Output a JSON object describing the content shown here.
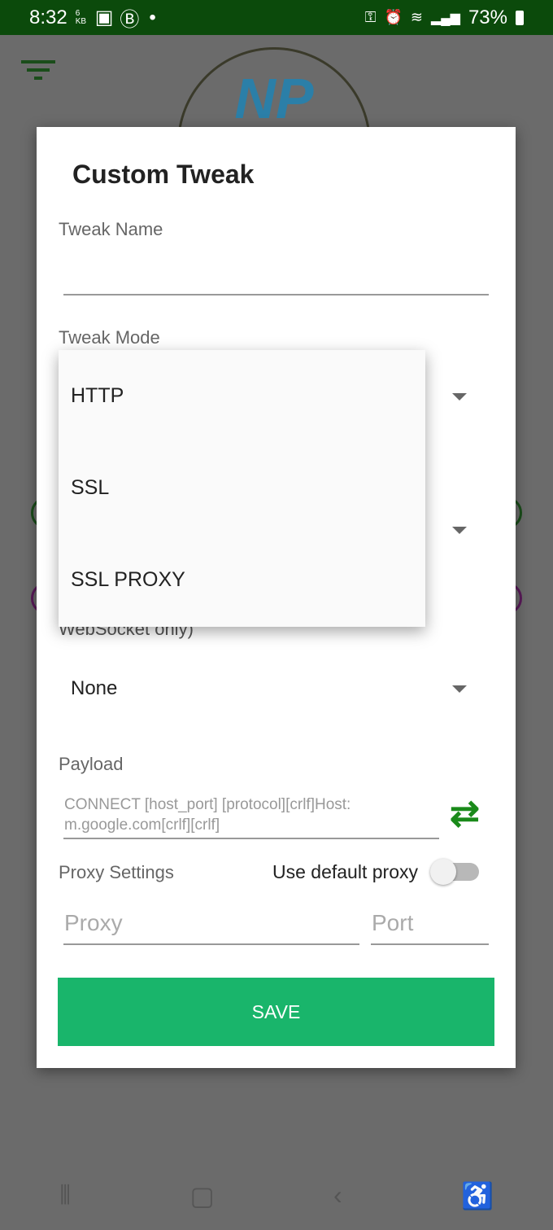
{
  "status_bar": {
    "time": "8:32",
    "data_speed": "6 KB",
    "battery": "73%",
    "left_icons": [
      "gallery-icon",
      "b-icon",
      "dot-icon"
    ],
    "right_icons": [
      "vpn-key-icon",
      "alarm-icon",
      "wifi-icon",
      "signal-icon",
      "volte-icon",
      "battery-icon"
    ]
  },
  "background": {
    "logo_text": "NP"
  },
  "dialog": {
    "title": "Custom Tweak",
    "tweak_name_label": "Tweak Name",
    "tweak_name_value": "",
    "tweak_mode_label": "Tweak Mode",
    "hidden_label_tail": "WebSocket only)",
    "websocket_value": "None",
    "payload_label": "Payload",
    "payload_placeholder": "CONNECT [host_port] [protocol][crlf]Host: m.google.com[crlf][crlf]",
    "proxy_settings_label": "Proxy Settings",
    "use_default_proxy_label": "Use default proxy",
    "use_default_proxy_on": false,
    "proxy_placeholder": "Proxy",
    "port_placeholder": "Port",
    "save_label": "SAVE",
    "save_color": "#19b56b"
  },
  "dropdown": {
    "options": [
      "HTTP",
      "SSL",
      "SSL PROXY"
    ]
  }
}
